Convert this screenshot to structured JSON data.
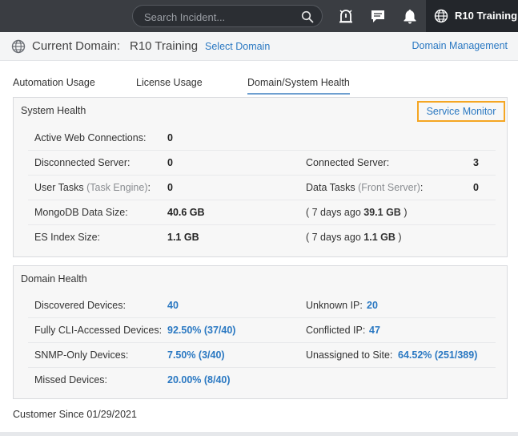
{
  "topbar": {
    "search_placeholder": "Search Incident...",
    "icons": [
      "search-icon",
      "incident-alert-icon",
      "chat-icon",
      "notification-bell-icon",
      "globe-icon"
    ],
    "domain_button_label": "R10 Training"
  },
  "domain_header": {
    "current_label": "Current Domain:",
    "current_value": "R10 Training",
    "select_domain": "Select Domain",
    "domain_management": "Domain Management"
  },
  "tabs": [
    {
      "label": "Automation Usage",
      "active": false
    },
    {
      "label": "License Usage",
      "active": false
    },
    {
      "label": "Domain/System Health",
      "active": true
    }
  ],
  "system_health": {
    "title": "System Health",
    "service_monitor": "Service Monitor",
    "rows": {
      "active_web": {
        "label": "Active Web Connections:",
        "value": "0"
      },
      "disconnected_server": {
        "label": "Disconnected Server:",
        "value": "0"
      },
      "connected_server": {
        "label": "Connected Server:",
        "value": "3"
      },
      "user_tasks": {
        "label": "User Tasks",
        "sub": "(Task Engine)",
        "colon": ":",
        "value": "0"
      },
      "data_tasks": {
        "label": "Data Tasks",
        "sub": "(Front Server)",
        "colon": ":",
        "value": "0"
      },
      "mongodb": {
        "label": "MongoDB Data Size:",
        "value": "40.6 GB",
        "compare_prefix": "( 7 days ago",
        "compare_value": "39.1 GB",
        "compare_suffix": ")"
      },
      "es_index": {
        "label": "ES Index Size:",
        "value": "1.1 GB",
        "compare_prefix": "( 7 days ago",
        "compare_value": "1.1 GB",
        "compare_suffix": ")"
      }
    }
  },
  "domain_health": {
    "title": "Domain Health",
    "rows": {
      "discovered": {
        "label": "Discovered Devices:",
        "value": "40"
      },
      "unknown_ip": {
        "label": "Unknown IP:",
        "value": "20"
      },
      "fully_cli": {
        "label": "Fully CLI-Accessed Devices:",
        "value": "92.50% (37/40)"
      },
      "conflicted_ip": {
        "label": "Conflicted IP:",
        "value": "47"
      },
      "snmp_only": {
        "label": "SNMP-Only Devices:",
        "value": "7.50% (3/40)"
      },
      "unassigned": {
        "label": "Unassigned to Site:",
        "value": "64.52% (251/389)"
      },
      "missed": {
        "label": "Missed Devices:",
        "value": "20.00% (8/40)"
      }
    }
  },
  "footer": {
    "customer_since": "Customer Since 01/29/2021"
  },
  "colors": {
    "topbar": "#3a3d42",
    "accent_link": "#2a78c2",
    "highlight_border": "#f5a623",
    "panel_bg": "#f7f7f7"
  }
}
